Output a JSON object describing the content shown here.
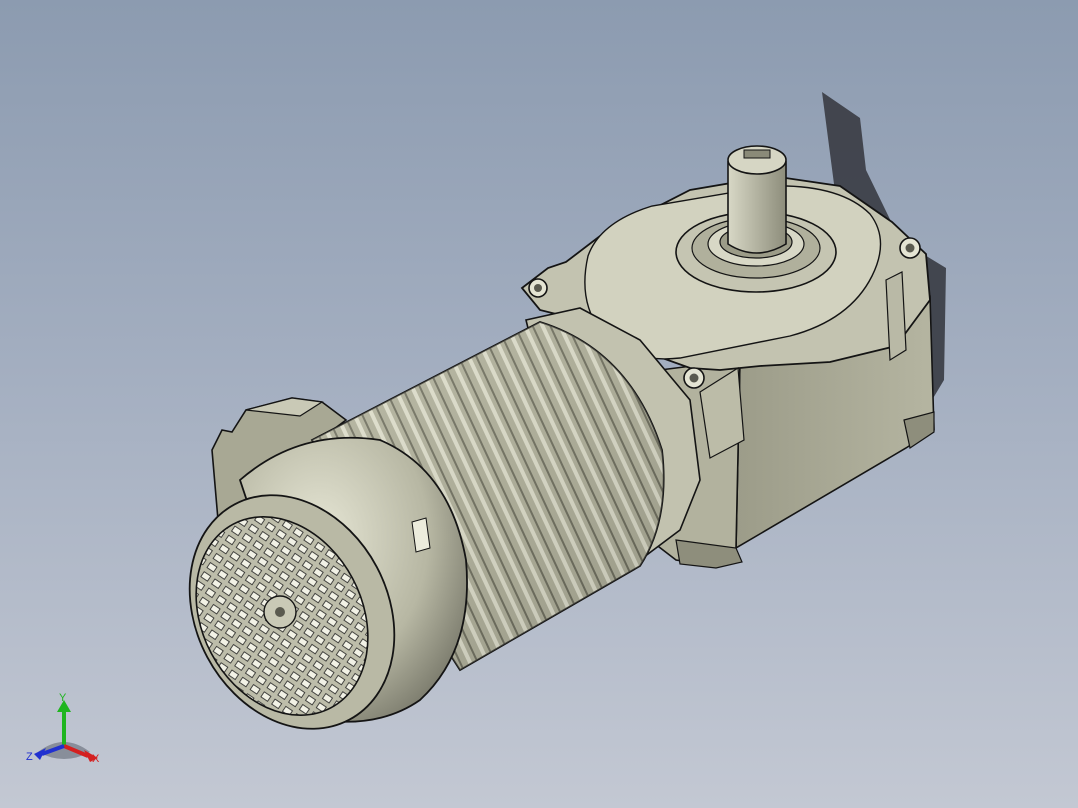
{
  "viewport": {
    "background_top": "#8c9bb0",
    "background_bottom": "#c3c8d3",
    "model": "geared-motor-3d-model"
  },
  "triad": {
    "x_label": "X",
    "y_label": "Y",
    "z_label": "Z",
    "x_color": "#d42020",
    "y_color": "#1fb51f",
    "z_color": "#2030d0"
  },
  "colors": {
    "body_light": "#c9c9b6",
    "body_mid": "#a7a792",
    "body_dark": "#77776a",
    "edge": "#141414",
    "shadow": "#3d4049"
  }
}
